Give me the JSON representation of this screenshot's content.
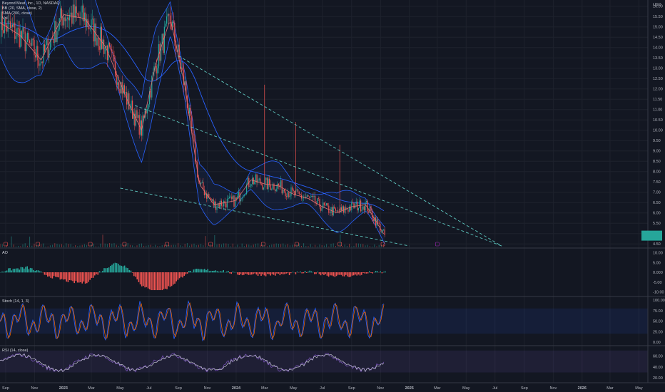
{
  "header": {
    "symbol_line": "Beyond Meat, Inc., 1D, NASDAQ",
    "indicator_bb": "BB (20, SMA, close, 2)",
    "indicator_sma": "SMA (200, close)",
    "indicator_vol": "Vol"
  },
  "price_axis": {
    "currency": "USD",
    "ticks": [
      "16.00",
      "15.50",
      "15.00",
      "14.50",
      "14.00",
      "13.50",
      "13.00",
      "12.50",
      "12.00",
      "11.50",
      "11.00",
      "10.50",
      "10.00",
      "9.50",
      "9.00",
      "8.50",
      "8.00",
      "7.50",
      "7.00",
      "6.50",
      "6.00",
      "5.50",
      "5.00",
      "4.50"
    ]
  },
  "panes": {
    "ao": {
      "title": "AO",
      "ticks": [
        "10.00",
        "5.00",
        "0.000",
        "-5.00",
        "-10.00"
      ]
    },
    "stoch": {
      "title": "Stoch (14, 1, 3)",
      "ticks": [
        "100.00",
        "75.00",
        "50.00",
        "25.00",
        "0.00"
      ]
    },
    "rsi": {
      "title": "RSI (14, close)",
      "ticks": [
        "60.00",
        "40.00",
        "20.00"
      ]
    }
  },
  "time_axis": {
    "labels": [
      "Sep",
      "Nov",
      "2023",
      "Mar",
      "May",
      "Jul",
      "Sep",
      "Nov",
      "2024",
      "Mar",
      "May",
      "Jul",
      "Sep",
      "Nov",
      "2025",
      "Mar",
      "May",
      "Jul",
      "Sep",
      "Nov",
      "2026",
      "Mar",
      "May"
    ]
  },
  "colors": {
    "background": "#131722",
    "bull": "#26a69a",
    "bear": "#ef5350",
    "bb_band": "#2962ff",
    "sma": "#e57373",
    "trend": "#5ec8c0",
    "stoch_k": "#2962ff",
    "stoch_d": "#ff6d00",
    "rsi_line": "#d1d4dc"
  },
  "chart_data": {
    "type": "line",
    "title": "Beyond Meat, Inc., 1D, NASDAQ",
    "xlabel": "",
    "ylabel": "USD",
    "ylim": [
      4.3,
      16.3
    ],
    "x": [
      "2022-08-20",
      "2022-10-01",
      "2022-11-15",
      "2023-01-01",
      "2023-02-15",
      "2023-04-01",
      "2023-05-15",
      "2023-06-15",
      "2023-07-15",
      "2023-08-15",
      "2023-09-15",
      "2023-10-15",
      "2023-11-15",
      "2024-01-01",
      "2024-02-01",
      "2024-03-01",
      "2024-04-01",
      "2024-05-01",
      "2024-06-01",
      "2024-07-01",
      "2024-08-01",
      "2024-09-01",
      "2024-10-01",
      "2024-11-10"
    ],
    "series": [
      {
        "values": [
          15.2,
          14.6,
          13.4,
          15.6,
          15.4,
          14.0,
          11.5,
          10.0,
          13.2,
          15.4,
          12.1,
          7.4,
          6.4,
          6.6,
          7.6,
          7.4,
          7.3,
          6.9,
          6.7,
          6.3,
          6.0,
          6.3,
          6.4,
          4.9
        ]
      }
    ],
    "trendlines": [
      {
        "from": [
          "2023-09-01",
          13.6
        ],
        "to": [
          "2025-07-15",
          4.4
        ]
      },
      {
        "from": [
          "2023-06-01",
          11.2
        ],
        "to": [
          "2025-07-15",
          4.4
        ]
      },
      {
        "from": [
          "2023-05-01",
          7.2
        ],
        "to": [
          "2025-01-01",
          4.4
        ]
      }
    ],
    "last_price": 4.9
  }
}
